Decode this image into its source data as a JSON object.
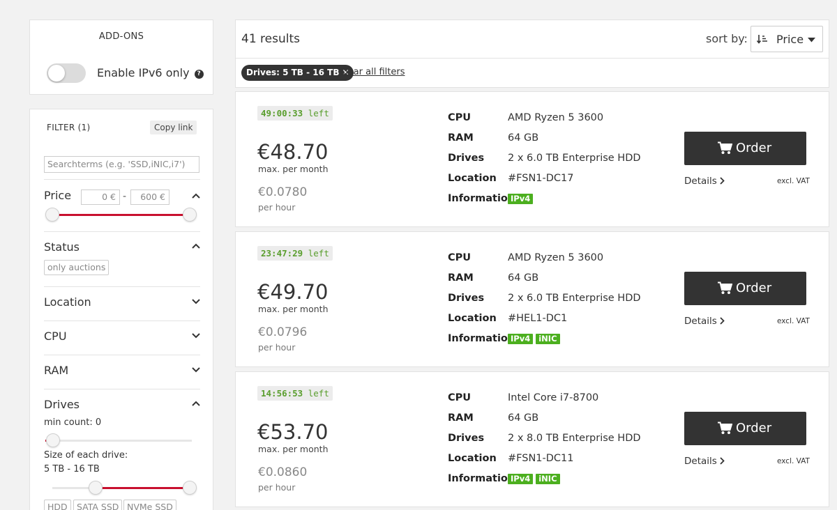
{
  "addons": {
    "title": "ADD-ONS",
    "ipv6_label": "Enable IPv6 only",
    "ipv6_enabled": false,
    "help_glyph": "?"
  },
  "filter": {
    "title": "FILTER (1)",
    "copy_link": "Copy link",
    "search_placeholder": "Searchterms (e.g. 'SSD,iNIC,i7')",
    "price": {
      "label": "Price",
      "min": "0 €",
      "max": "600 €",
      "range_min": 0,
      "range_max": 600
    },
    "status": {
      "label": "Status",
      "chip": "only auctions"
    },
    "location": {
      "label": "Location"
    },
    "cpu": {
      "label": "CPU"
    },
    "ram": {
      "label": "RAM"
    },
    "drives": {
      "label": "Drives",
      "min_count_label": "min count: 0",
      "min_count": 0,
      "size_label": "Size of each drive:",
      "size_range": "5 TB - 16 TB",
      "chips": [
        "HDD",
        "SATA SSD",
        "NVMe SSD"
      ]
    }
  },
  "results": {
    "count_text": "41 results",
    "sort_label": "sort by:",
    "sort_value": "Price"
  },
  "active_filters": {
    "chip": "Drives: 5 TB - 16 TB",
    "remove_glyph": "✕",
    "clear_all": "Clear all filters"
  },
  "spec_keys": {
    "cpu": "CPU",
    "ram": "RAM",
    "drives": "Drives",
    "location": "Location",
    "information": "Information"
  },
  "common": {
    "left_word": "left",
    "per_month": "max. per month",
    "per_hour": "per hour",
    "order": "Order",
    "details": "Details",
    "vat": "excl. VAT"
  },
  "servers": [
    {
      "timer": "49:00:33",
      "price_month": "€48.70",
      "price_hour": "€0.0780",
      "cpu": "AMD Ryzen 5 3600",
      "ram": "64 GB",
      "drives": "2 x 6.0 TB Enterprise HDD",
      "location": "#FSN1-DC17",
      "tags": [
        "IPv4"
      ]
    },
    {
      "timer": "23:47:29",
      "price_month": "€49.70",
      "price_hour": "€0.0796",
      "cpu": "AMD Ryzen 5 3600",
      "ram": "64 GB",
      "drives": "2 x 6.0 TB Enterprise HDD",
      "location": "#HEL1-DC1",
      "tags": [
        "IPv4",
        "iNIC"
      ]
    },
    {
      "timer": "14:56:53",
      "price_month": "€53.70",
      "price_hour": "€0.0860",
      "cpu": "Intel Core i7-8700",
      "ram": "64 GB",
      "drives": "2 x 8.0 TB Enterprise HDD",
      "location": "#FSN1-DC11",
      "tags": [
        "IPv4",
        "iNIC"
      ]
    }
  ],
  "colors": {
    "accent_red": "#c8102e",
    "tag_green": "#4caf1f",
    "timer_green": "#5a9e2e",
    "button_dark": "#333333"
  }
}
